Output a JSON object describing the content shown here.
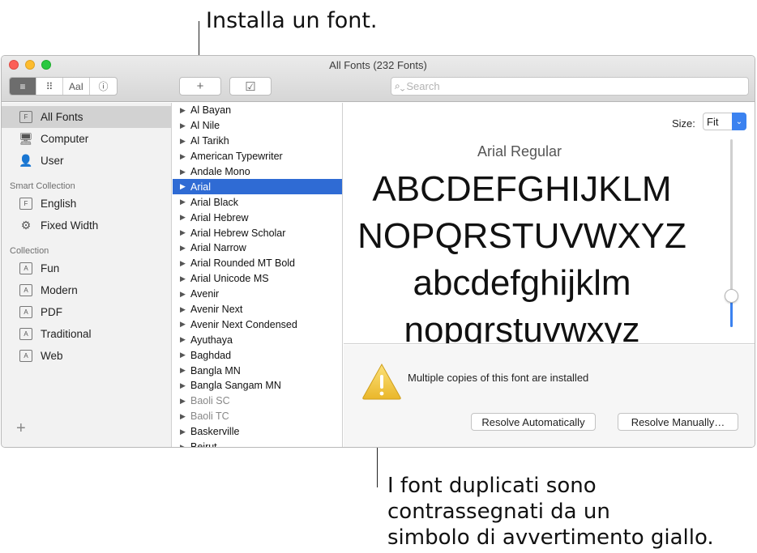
{
  "callouts": {
    "top": "Installa un font.",
    "bottom_lines": [
      "I font duplicati sono",
      "contrassegnati da un",
      "simbolo di avvertimento giallo."
    ]
  },
  "window": {
    "title": "All Fonts (232 Fonts)"
  },
  "toolbar": {
    "view_buttons": [
      {
        "name": "sample-view-icon",
        "glyph": "≡"
      },
      {
        "name": "grid-view-icon",
        "glyph": "⠿"
      },
      {
        "name": "custom-preview-icon",
        "glyph": "AaI"
      },
      {
        "name": "info-icon",
        "glyph": "ⓘ"
      }
    ],
    "add_glyph": "+",
    "validate_glyph": "☑",
    "search_placeholder": "Search"
  },
  "sidebar": {
    "library": [
      {
        "label": "All Fonts",
        "icon": "F",
        "selected": true
      },
      {
        "label": "Computer",
        "icon": "🖥"
      },
      {
        "label": "User",
        "icon": "👤"
      }
    ],
    "smart_heading": "Smart Collection",
    "smart": [
      {
        "label": "English",
        "icon": "F"
      },
      {
        "label": "Fixed Width",
        "icon": "⚙"
      }
    ],
    "collection_heading": "Collection",
    "collections": [
      {
        "label": "Fun",
        "icon": "A"
      },
      {
        "label": "Modern",
        "icon": "A"
      },
      {
        "label": "PDF",
        "icon": "A"
      },
      {
        "label": "Traditional",
        "icon": "A"
      },
      {
        "label": "Web",
        "icon": "A"
      }
    ],
    "add_glyph": "+"
  },
  "fonts": [
    {
      "label": "Al Bayan"
    },
    {
      "label": "Al Nile"
    },
    {
      "label": "Al Tarikh"
    },
    {
      "label": "American Typewriter"
    },
    {
      "label": "Andale Mono"
    },
    {
      "label": "Arial",
      "selected": true
    },
    {
      "label": "Arial Black"
    },
    {
      "label": "Arial Hebrew"
    },
    {
      "label": "Arial Hebrew Scholar"
    },
    {
      "label": "Arial Narrow"
    },
    {
      "label": "Arial Rounded MT Bold"
    },
    {
      "label": "Arial Unicode MS"
    },
    {
      "label": "Avenir"
    },
    {
      "label": "Avenir Next"
    },
    {
      "label": "Avenir Next Condensed"
    },
    {
      "label": "Ayuthaya"
    },
    {
      "label": "Baghdad"
    },
    {
      "label": "Bangla MN"
    },
    {
      "label": "Bangla Sangam MN"
    },
    {
      "label": "Baoli SC",
      "dim": true
    },
    {
      "label": "Baoli TC",
      "dim": true
    },
    {
      "label": "Baskerville"
    },
    {
      "label": "Beirut"
    }
  ],
  "preview": {
    "size_label": "Size:",
    "size_value": "Fit",
    "size_slider_fraction": 0.85,
    "font_name": "Arial Regular",
    "lines": [
      "ABCDEFGHIJKLM",
      "NOPQRSTUVWXYZ",
      "abcdefghijklm",
      "nopqrstuvwxyz"
    ]
  },
  "warning": {
    "message": "Multiple copies of this font are installed",
    "resolve_auto": "Resolve Automatically",
    "resolve_manual": "Resolve Manually…",
    "icon_color": "#f5c528"
  }
}
